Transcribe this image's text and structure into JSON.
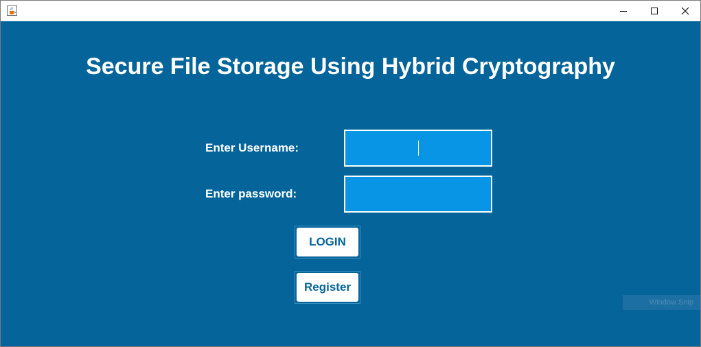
{
  "window": {
    "controls": {
      "minimize_icon": "minimize-icon",
      "maximize_icon": "maximize-icon",
      "close_icon": "close-icon"
    },
    "app_icon": "java-coffee-cup-icon"
  },
  "main": {
    "title": "Secure File Storage Using Hybrid Cryptography",
    "username_label": "Enter Username:",
    "password_label": "Enter password:",
    "username_value": "",
    "password_value": "",
    "login_label": "LOGIN",
    "register_label": "Register"
  },
  "overlay": {
    "snip_label": "Window Snip"
  },
  "colors": {
    "background": "#05659b",
    "field_fill": "#0895e6",
    "text": "#ffffff",
    "button_text": "#05659b"
  }
}
